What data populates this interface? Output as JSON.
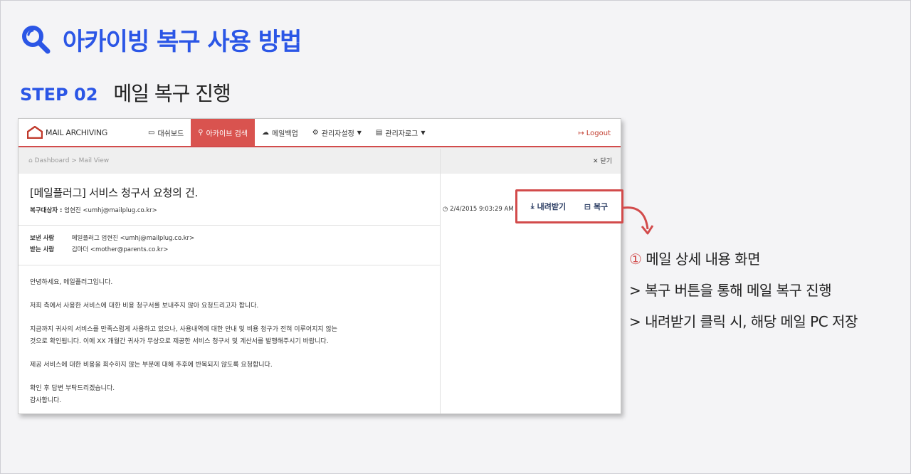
{
  "page": {
    "title": "아카이빙 복구 사용 방법",
    "step_number": "STEP 02",
    "step_name": "메일 복구 진행"
  },
  "app": {
    "logo_text": "MAIL ARCHIVING",
    "nav": [
      {
        "label": "대쉬보드",
        "icon": "monitor-icon"
      },
      {
        "label": "아카이브 검색",
        "icon": "search-icon",
        "active": true
      },
      {
        "label": "메일백업",
        "icon": "cloud-icon"
      },
      {
        "label": "관리자설정",
        "icon": "gear-icon",
        "caret": true
      },
      {
        "label": "관리자로그",
        "icon": "list-icon",
        "caret": true
      }
    ],
    "logout": "Logout",
    "breadcrumb": "Dashboard  >  Mail View",
    "close_label": "닫기",
    "mail": {
      "subject": "[메일플러그] 서비스 청구서 요청의 건.",
      "recover_label": "복구대상자 :",
      "recover_value": "엄현진 <umhj@mailplug.co.kr>",
      "datetime": "2/4/2015 9:03:29 AM",
      "from_label": "보낸 사람",
      "from_value": "메일플러그 엄현진 <umhj@mailplug.co.kr>",
      "to_label": "받는 사람",
      "to_value": "김마더 <mother@parents.co.kr>",
      "body": [
        "안녕하세요, 메일플러그입니다.",
        "",
        "저희 측에서 사용한 서비스에 대한 비용 청구서를 보내주지 않아 요청드리고자 합니다.",
        "",
        "지금까지 귀사의 서비스를 만족스럽게 사용하고 있으나, 사용내역에 대한 안내 및 비용 청구가 전혀 이루어지지 않는",
        "것으로 확인됩니다. 이에 XX 개월간 귀사가 무상으로 제공한 서비스 청구서 및 계산서를 발행해주시기 바랍니다.",
        "",
        "제공 서비스에 대한 비용을 회수하지 않는 부분에 대해 추후에 반복되지 않도록 요청합니다.",
        "",
        "확인 후 답변 부탁드리겠습니다.",
        "감사합니다."
      ]
    },
    "actions": {
      "download": "내려받기",
      "restore": "복구"
    }
  },
  "notes": {
    "marker": "①",
    "line1": "메일 상세 내용 화면",
    "line2": "> 복구 버튼을 통해 메일 복구 진행",
    "line3": "> 내려받기 클릭 시, 해당 메일 PC 저장"
  },
  "colors": {
    "accent_blue": "#2b56e6",
    "brand_red": "#d24b4b"
  }
}
